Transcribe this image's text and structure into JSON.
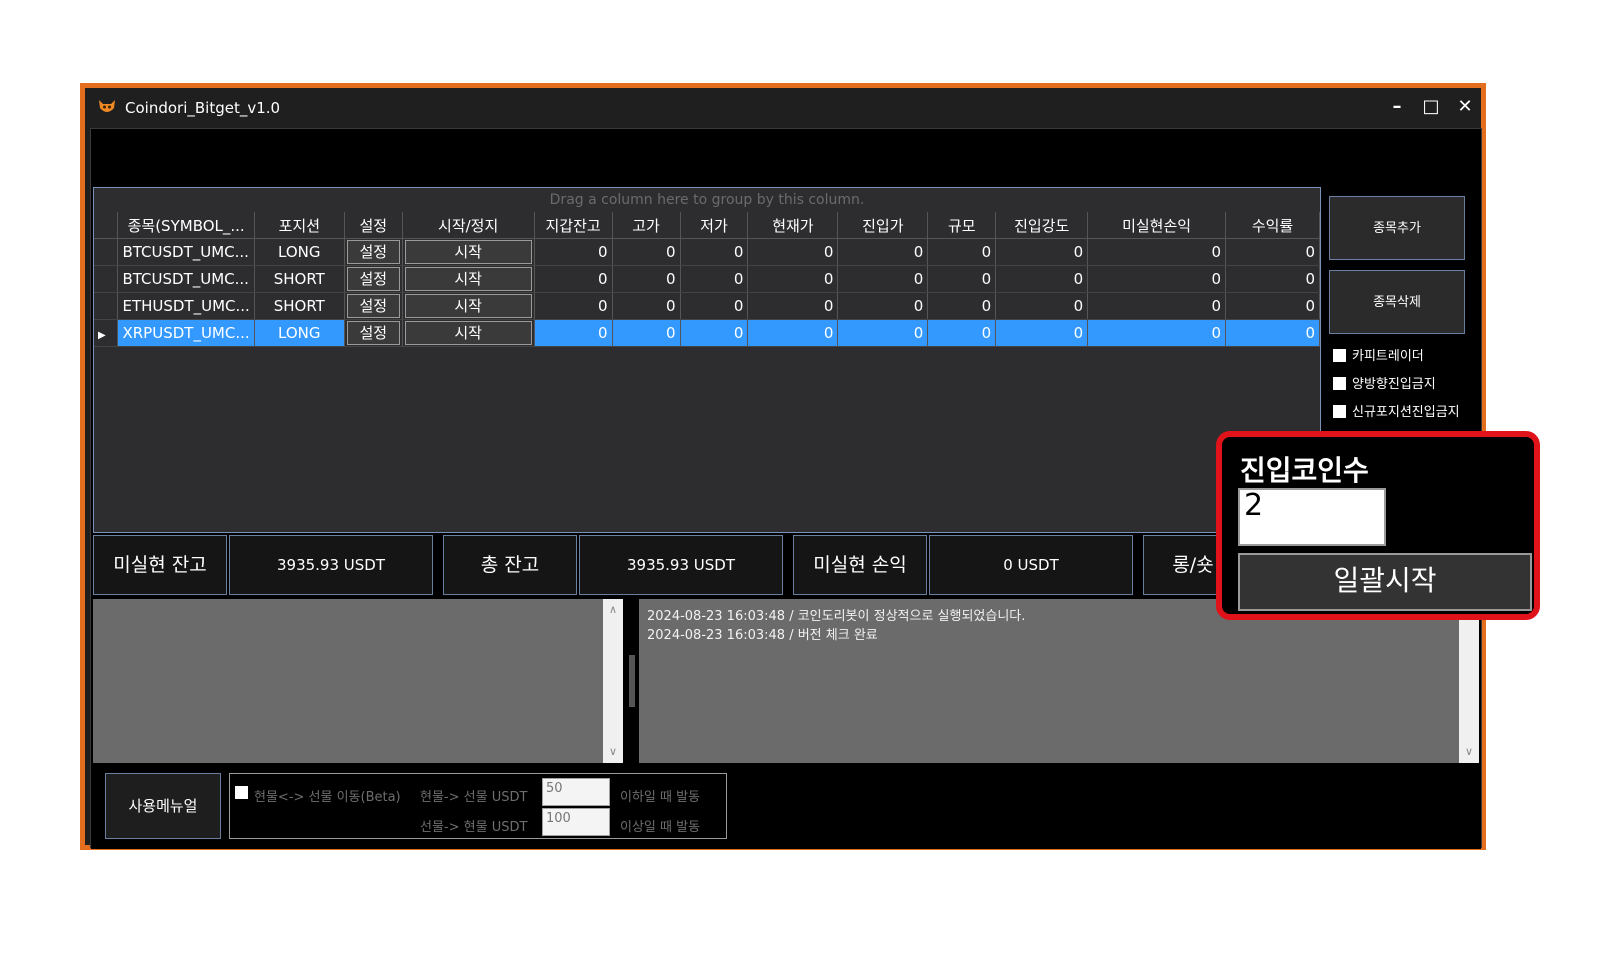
{
  "window": {
    "title": "Coindori_Bitget_v1.0",
    "minimize": "–",
    "maximize": "□",
    "close": "✕",
    "accent_color": "#e36f1e"
  },
  "grid": {
    "drag_hint": "Drag a column here to group by this column.",
    "columns": [
      "종목(SYMBOL_...",
      "포지션",
      "설정",
      "시작/정지",
      "지갑잔고",
      "고가",
      "저가",
      "현재가",
      "진입가",
      "규모",
      "진입강도",
      "미실현손익",
      "수익률"
    ],
    "rows": [
      {
        "symbol": "BTCUSDT_UMC...",
        "position": "LONG",
        "settings": "설정",
        "start": "시작",
        "wallet": "0",
        "high": "0",
        "low": "0",
        "current": "0",
        "entry": "0",
        "size": "0",
        "strength": "0",
        "pnl": "0",
        "roi": "0"
      },
      {
        "symbol": "BTCUSDT_UMC...",
        "position": "SHORT",
        "settings": "설정",
        "start": "시작",
        "wallet": "0",
        "high": "0",
        "low": "0",
        "current": "0",
        "entry": "0",
        "size": "0",
        "strength": "0",
        "pnl": "0",
        "roi": "0"
      },
      {
        "symbol": "ETHUSDT_UMC...",
        "position": "SHORT",
        "settings": "설정",
        "start": "시작",
        "wallet": "0",
        "high": "0",
        "low": "0",
        "current": "0",
        "entry": "0",
        "size": "0",
        "strength": "0",
        "pnl": "0",
        "roi": "0"
      },
      {
        "symbol": "XRPUSDT_UMC...",
        "position": "LONG",
        "settings": "설정",
        "start": "시작",
        "wallet": "0",
        "high": "0",
        "low": "0",
        "current": "0",
        "entry": "0",
        "size": "0",
        "strength": "0",
        "pnl": "0",
        "roi": "0"
      }
    ],
    "selected_row_color": "#3399ff"
  },
  "side": {
    "add_label": "종목추가",
    "delete_label": "종목삭제",
    "checkboxes": [
      "카피트레이더",
      "양방향진입금지",
      "신규포지션진입금지"
    ]
  },
  "stats": {
    "unrealized_balance_label": "미실현 잔고",
    "unrealized_balance_value": "3935.93 USDT",
    "total_balance_label": "총 잔고",
    "total_balance_value": "3935.93 USDT",
    "unrealized_pnl_label": "미실현 손익",
    "unrealized_pnl_value": "0 USDT",
    "long_short_label": "롱/숏"
  },
  "log": {
    "lines": [
      "2024-08-23 16:03:48 / 코인도리봇이 정상적으로 실행되었습니다.",
      "2024-08-23 16:03:48 / 버전 체크 완료"
    ]
  },
  "bottom": {
    "manual_label": "사용메뉴얼",
    "transfer_checkbox_label": "현물<-> 선물 이동(Beta)",
    "spot_to_futures_label": "현물-> 선물 USDT",
    "spot_to_futures_value": "50",
    "spot_to_futures_cond": "이하일 때 발동",
    "futures_to_spot_label": "선물-> 현물 USDT",
    "futures_to_spot_value": "100",
    "futures_to_spot_cond": "이상일 때 발동"
  },
  "callout": {
    "label": "진입코인수",
    "value": "2",
    "button_label": "일괄시작",
    "border_color": "#e0131a"
  }
}
